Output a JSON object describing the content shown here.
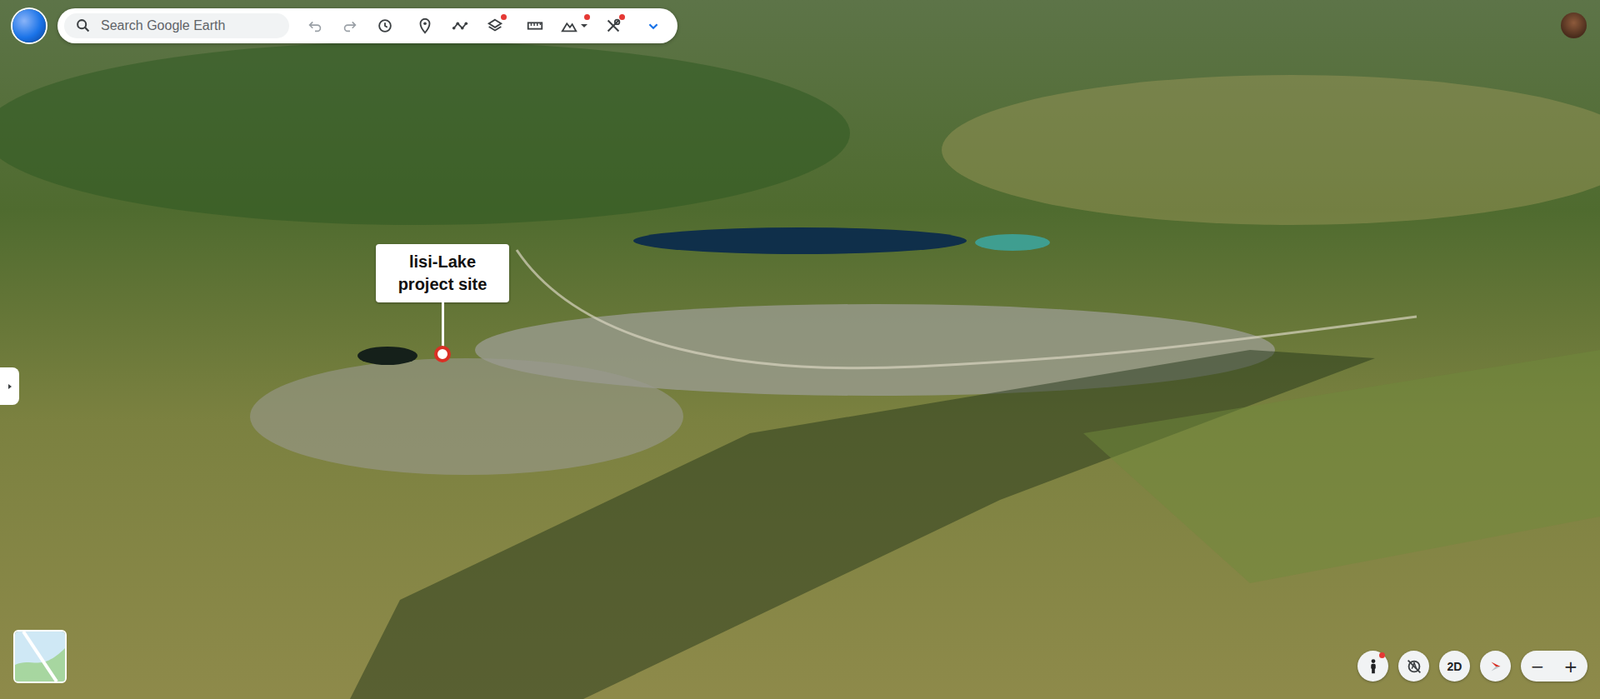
{
  "search": {
    "placeholder": "Search Google Earth"
  },
  "toolbar": {
    "undo": {
      "disabled": true
    },
    "redo": {
      "disabled": true
    },
    "history": {
      "notification": false
    },
    "placemark": {
      "notification": false
    },
    "path": {
      "notification": false
    },
    "layers": {
      "notification": true
    },
    "measure": {
      "notification": false
    },
    "elevation": {
      "notification": true
    },
    "tools": {
      "notification": true
    },
    "expand": {
      "notification": false
    }
  },
  "map": {
    "pins": [
      {
        "label": "lisi-Lake project site"
      }
    ]
  },
  "controls": {
    "street_view": {
      "notification": true
    },
    "dimension": {
      "label": "2D"
    },
    "zoom_out": {
      "label": "−"
    },
    "zoom_in": {
      "label": "+"
    }
  }
}
